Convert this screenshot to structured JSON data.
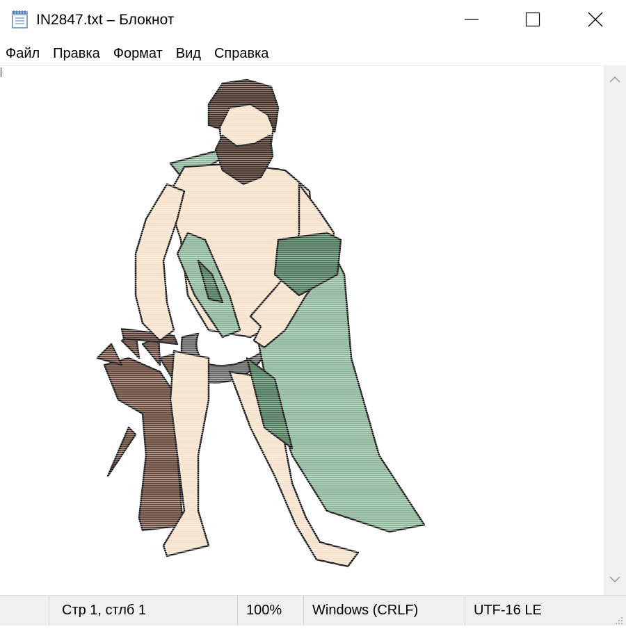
{
  "window": {
    "title": "IN2847.txt – Блокнот",
    "icon": "notepad-icon",
    "buttons": {
      "minimize": "minimize-icon",
      "maximize": "maximize-icon",
      "close": "close-icon"
    }
  },
  "menu": [
    "Файл",
    "Правка",
    "Формат",
    "Вид",
    "Справка"
  ],
  "editor": {
    "content_description_icon": "ascii-art-cronos-figure",
    "colors": {
      "skin": "#f7e1cb",
      "outline": "#1b1b1b",
      "robe": "#8cb79a",
      "robe_dark": "#4c7a5a",
      "beard": "#4a3328",
      "scythe": "#6b6b6b",
      "wheat": "#6a4a3c"
    }
  },
  "status": {
    "position": "Стр 1, стлб 1",
    "zoom": "100%",
    "line_endings": "Windows (CRLF)",
    "encoding": "UTF-16 LE"
  }
}
